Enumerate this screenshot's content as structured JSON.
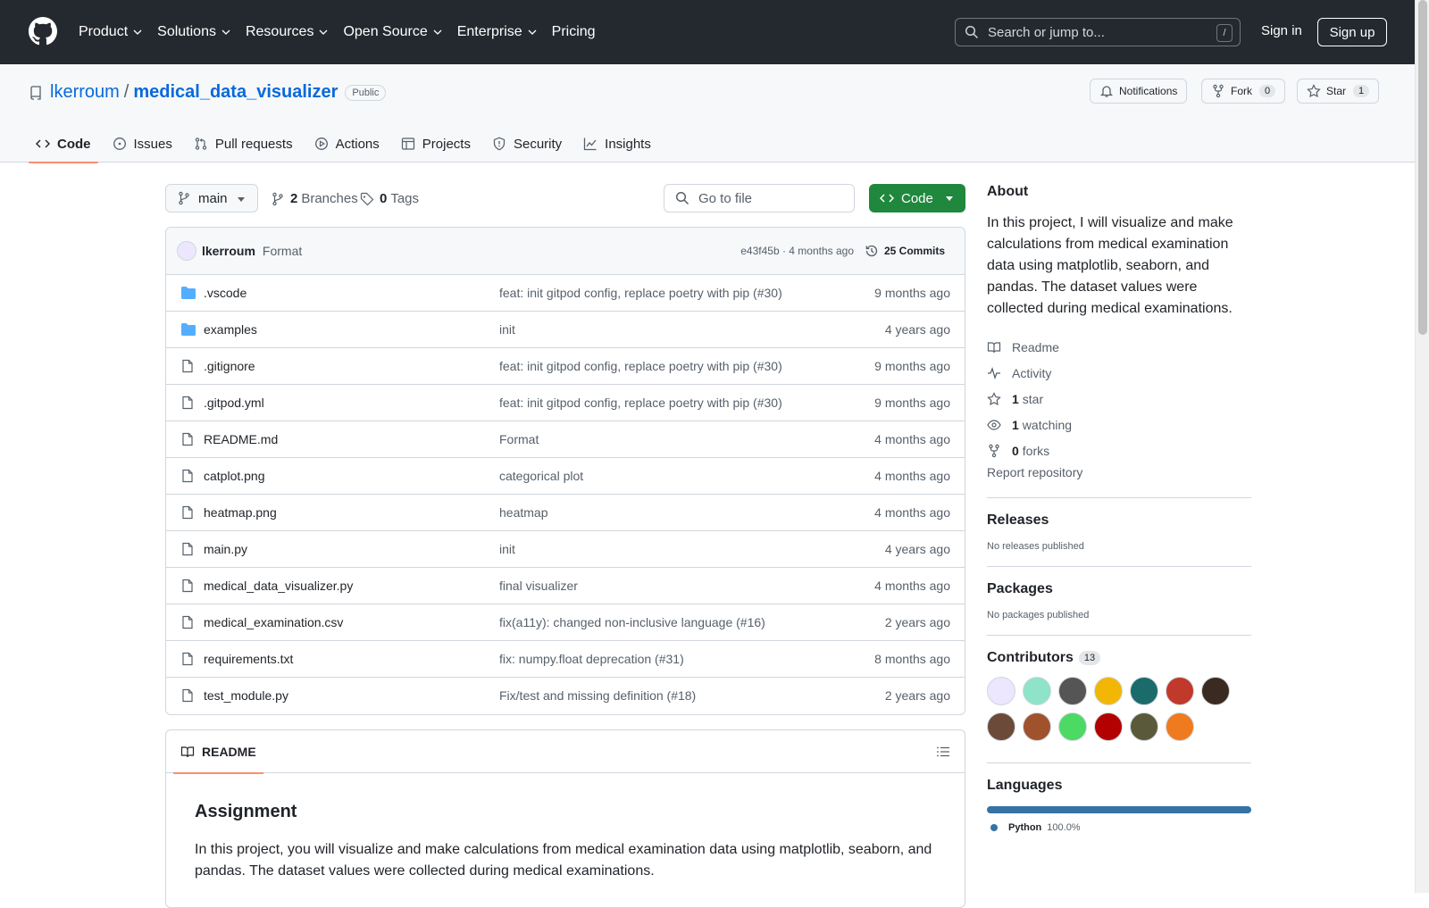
{
  "header": {
    "nav": [
      {
        "label": "Product",
        "dropdown": true
      },
      {
        "label": "Solutions",
        "dropdown": true
      },
      {
        "label": "Resources",
        "dropdown": true
      },
      {
        "label": "Open Source",
        "dropdown": true
      },
      {
        "label": "Enterprise",
        "dropdown": true
      },
      {
        "label": "Pricing",
        "dropdown": false
      }
    ],
    "search_placeholder": "Search or jump to...",
    "search_shortcut": "/",
    "sign_in": "Sign in",
    "sign_up": "Sign up"
  },
  "repo": {
    "owner": "lkerroum",
    "separator": "/",
    "name": "medical_data_visualizer",
    "visibility": "Public",
    "notifications_label": "Notifications",
    "fork_label": "Fork",
    "fork_count": "0",
    "star_label": "Star",
    "star_count": "1"
  },
  "tabs": [
    {
      "label": "Code",
      "icon": "code-icon",
      "active": true
    },
    {
      "label": "Issues",
      "icon": "issue-icon",
      "active": false
    },
    {
      "label": "Pull requests",
      "icon": "pull-request-icon",
      "active": false
    },
    {
      "label": "Actions",
      "icon": "play-icon",
      "active": false
    },
    {
      "label": "Projects",
      "icon": "table-icon",
      "active": false
    },
    {
      "label": "Security",
      "icon": "shield-icon",
      "active": false
    },
    {
      "label": "Insights",
      "icon": "graph-icon",
      "active": false
    }
  ],
  "toolbar": {
    "branch": "main",
    "branches_count": "2",
    "branches_label": "Branches",
    "tags_count": "0",
    "tags_label": "Tags",
    "go_to_file": "Go to file",
    "code_button": "Code"
  },
  "latest_commit": {
    "author": "lkerroum",
    "message": "Format",
    "sha_time": "e43f45b · 4 months ago",
    "commits_label": "25 Commits"
  },
  "files": [
    {
      "name": ".vscode",
      "type": "dir",
      "message": "feat: init gitpod config, replace poetry with pip (#30)",
      "date": "9 months ago"
    },
    {
      "name": "examples",
      "type": "dir",
      "message": "init",
      "date": "4 years ago"
    },
    {
      "name": ".gitignore",
      "type": "file",
      "message": "feat: init gitpod config, replace poetry with pip (#30)",
      "date": "9 months ago"
    },
    {
      "name": ".gitpod.yml",
      "type": "file",
      "message": "feat: init gitpod config, replace poetry with pip (#30)",
      "date": "9 months ago"
    },
    {
      "name": "README.md",
      "type": "file",
      "message": "Format",
      "date": "4 months ago"
    },
    {
      "name": "catplot.png",
      "type": "file",
      "message": "categorical plot",
      "date": "4 months ago"
    },
    {
      "name": "heatmap.png",
      "type": "file",
      "message": "heatmap",
      "date": "4 months ago"
    },
    {
      "name": "main.py",
      "type": "file",
      "message": "init",
      "date": "4 years ago"
    },
    {
      "name": "medical_data_visualizer.py",
      "type": "file",
      "message": "final visualizer",
      "date": "4 months ago"
    },
    {
      "name": "medical_examination.csv",
      "type": "file",
      "message": "fix(a11y): changed non-inclusive language (#16)",
      "date": "2 years ago"
    },
    {
      "name": "requirements.txt",
      "type": "file",
      "message": "fix: numpy.float deprecation (#31)",
      "date": "8 months ago"
    },
    {
      "name": "test_module.py",
      "type": "file",
      "message": "Fix/test and missing definition (#18)",
      "date": "2 years ago"
    }
  ],
  "readme": {
    "tab_label": "README",
    "heading": "Assignment",
    "body": "In this project, you will visualize and make calculations from medical examination data using matplotlib, seaborn, and pandas. The dataset values were collected during medical examinations."
  },
  "sidebar": {
    "about_title": "About",
    "about_desc": "In this project, I will visualize and make calculations from medical examination data using matplotlib, seaborn, and pandas. The dataset values were collected during medical examinations.",
    "readme_label": "Readme",
    "activity_label": "Activity",
    "stars_count": "1",
    "stars_label": "star",
    "watching_count": "1",
    "watching_label": "watching",
    "forks_count": "0",
    "forks_label": "forks",
    "report_label": "Report repository",
    "releases_title": "Releases",
    "releases_empty": "No releases published",
    "packages_title": "Packages",
    "packages_empty": "No packages published",
    "contributors_title": "Contributors",
    "contributors_count": "13",
    "contributor_colors": [
      "#ece6ff",
      "#8fe3c8",
      "#555555",
      "#f2b705",
      "#1b6b6b",
      "#c0392b",
      "#3b2a22",
      "#6b4a3a",
      "#a0522d",
      "#4cd964",
      "#b30000",
      "#5a5a3a",
      "#f07a1e"
    ],
    "languages_title": "Languages",
    "languages": [
      {
        "name": "Python",
        "percent": "100.0%",
        "color": "#3572a5"
      }
    ]
  }
}
